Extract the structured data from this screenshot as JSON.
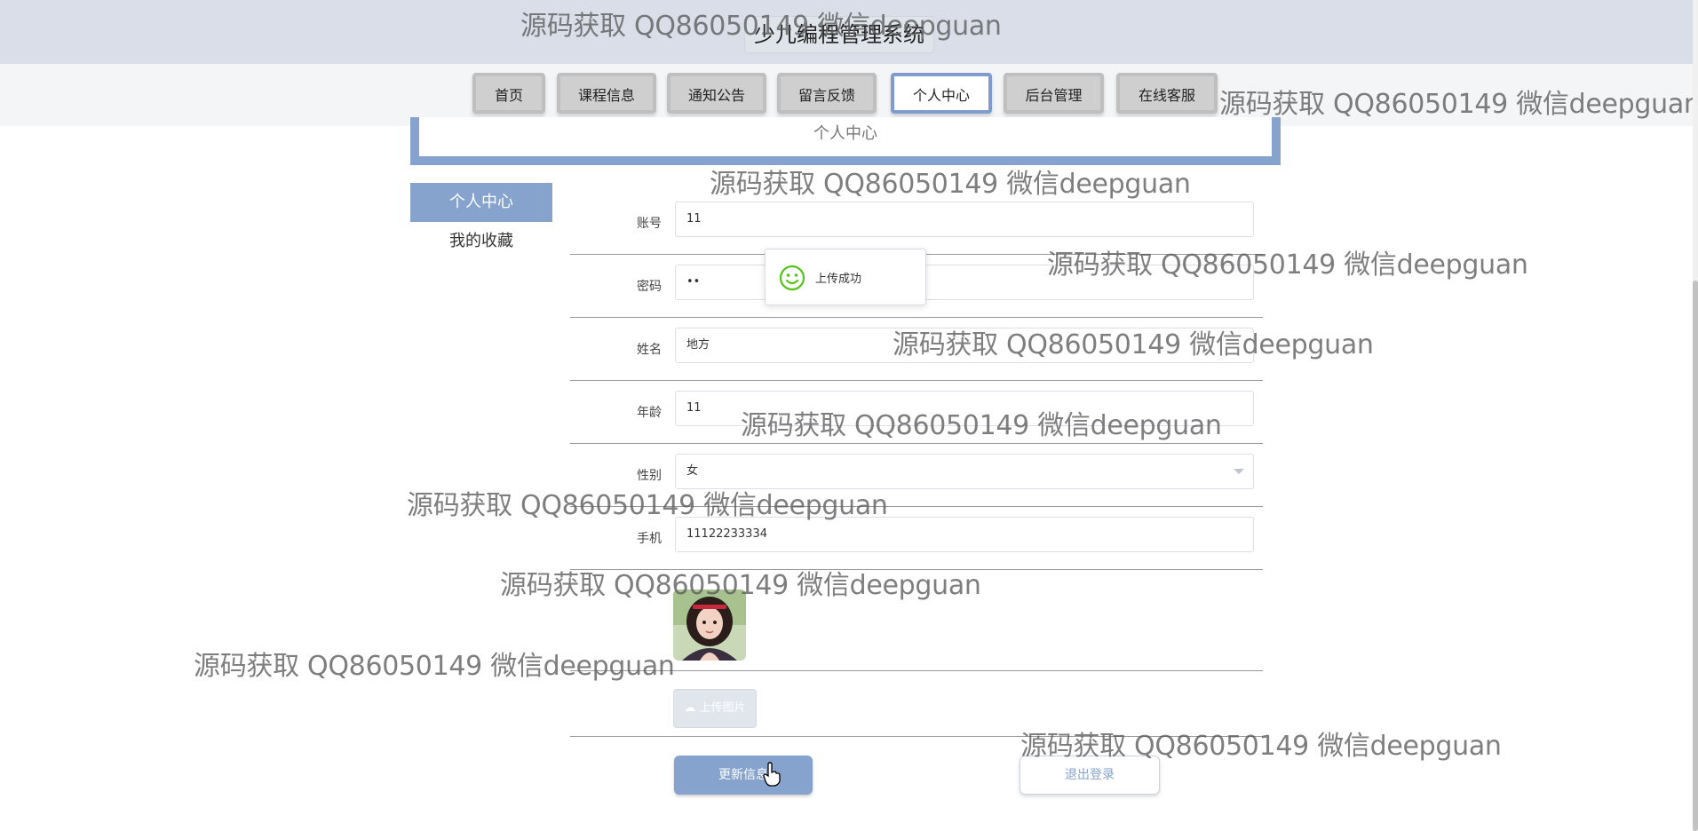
{
  "header": {
    "title": "少儿编程管理系统"
  },
  "nav": {
    "items": [
      {
        "label": "首页"
      },
      {
        "label": "课程信息"
      },
      {
        "label": "通知公告"
      },
      {
        "label": "留言反馈"
      },
      {
        "label": "个人中心",
        "active": true
      },
      {
        "label": "后台管理"
      },
      {
        "label": "在线客服"
      }
    ]
  },
  "breadcrumb": {
    "label": "个人中心"
  },
  "sidebar": {
    "items": [
      {
        "label": "个人中心",
        "active": true
      },
      {
        "label": "我的收藏"
      }
    ]
  },
  "form": {
    "account": {
      "label": "账号",
      "value": "11"
    },
    "password": {
      "label": "密码",
      "value": "••"
    },
    "name": {
      "label": "姓名",
      "value": "地方"
    },
    "age": {
      "label": "年龄",
      "value": "11"
    },
    "gender": {
      "label": "性别",
      "value": "女"
    },
    "phone": {
      "label": "手机",
      "value": "11122233334"
    },
    "upload_label": "上传图片",
    "update_button": "更新信息",
    "logout_button": "退出登录"
  },
  "toast": {
    "message": "上传成功"
  },
  "watermark": {
    "text": "源码获取 QQ86050149 微信deepguan"
  },
  "colors": {
    "accent": "#86a3cd",
    "topbar": "#d9dee8",
    "toast_icon": "#52c41a"
  }
}
